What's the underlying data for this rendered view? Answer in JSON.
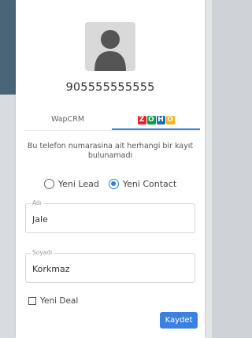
{
  "contact": {
    "phone": "905555555555"
  },
  "tabs": [
    {
      "label": "WapCRM",
      "active": false
    },
    {
      "label": "ZOHO",
      "active": true,
      "logo_letters": [
        "Z",
        "O",
        "H",
        "O"
      ],
      "logo_colors": [
        "#e42527",
        "#089949",
        "#226db4",
        "#f9b21d"
      ]
    }
  ],
  "message": "Bu telefon numarasina ait herhangi bir kayıt bulunamadı",
  "record_type": {
    "options": [
      {
        "label": "Yeni Lead",
        "checked": false
      },
      {
        "label": "Yeni Contact",
        "checked": true
      }
    ]
  },
  "form": {
    "first_name": {
      "label": "Adı",
      "value": "Jale"
    },
    "last_name": {
      "label": "Soyadı",
      "value": "Korkmaz"
    },
    "new_deal": {
      "label": "Yeni Deal",
      "checked": false
    },
    "save_label": "Kaydet"
  },
  "colors": {
    "accent": "#3b82e0",
    "avatar_bg": "#d9d9d9",
    "avatar_fg": "#555555"
  }
}
